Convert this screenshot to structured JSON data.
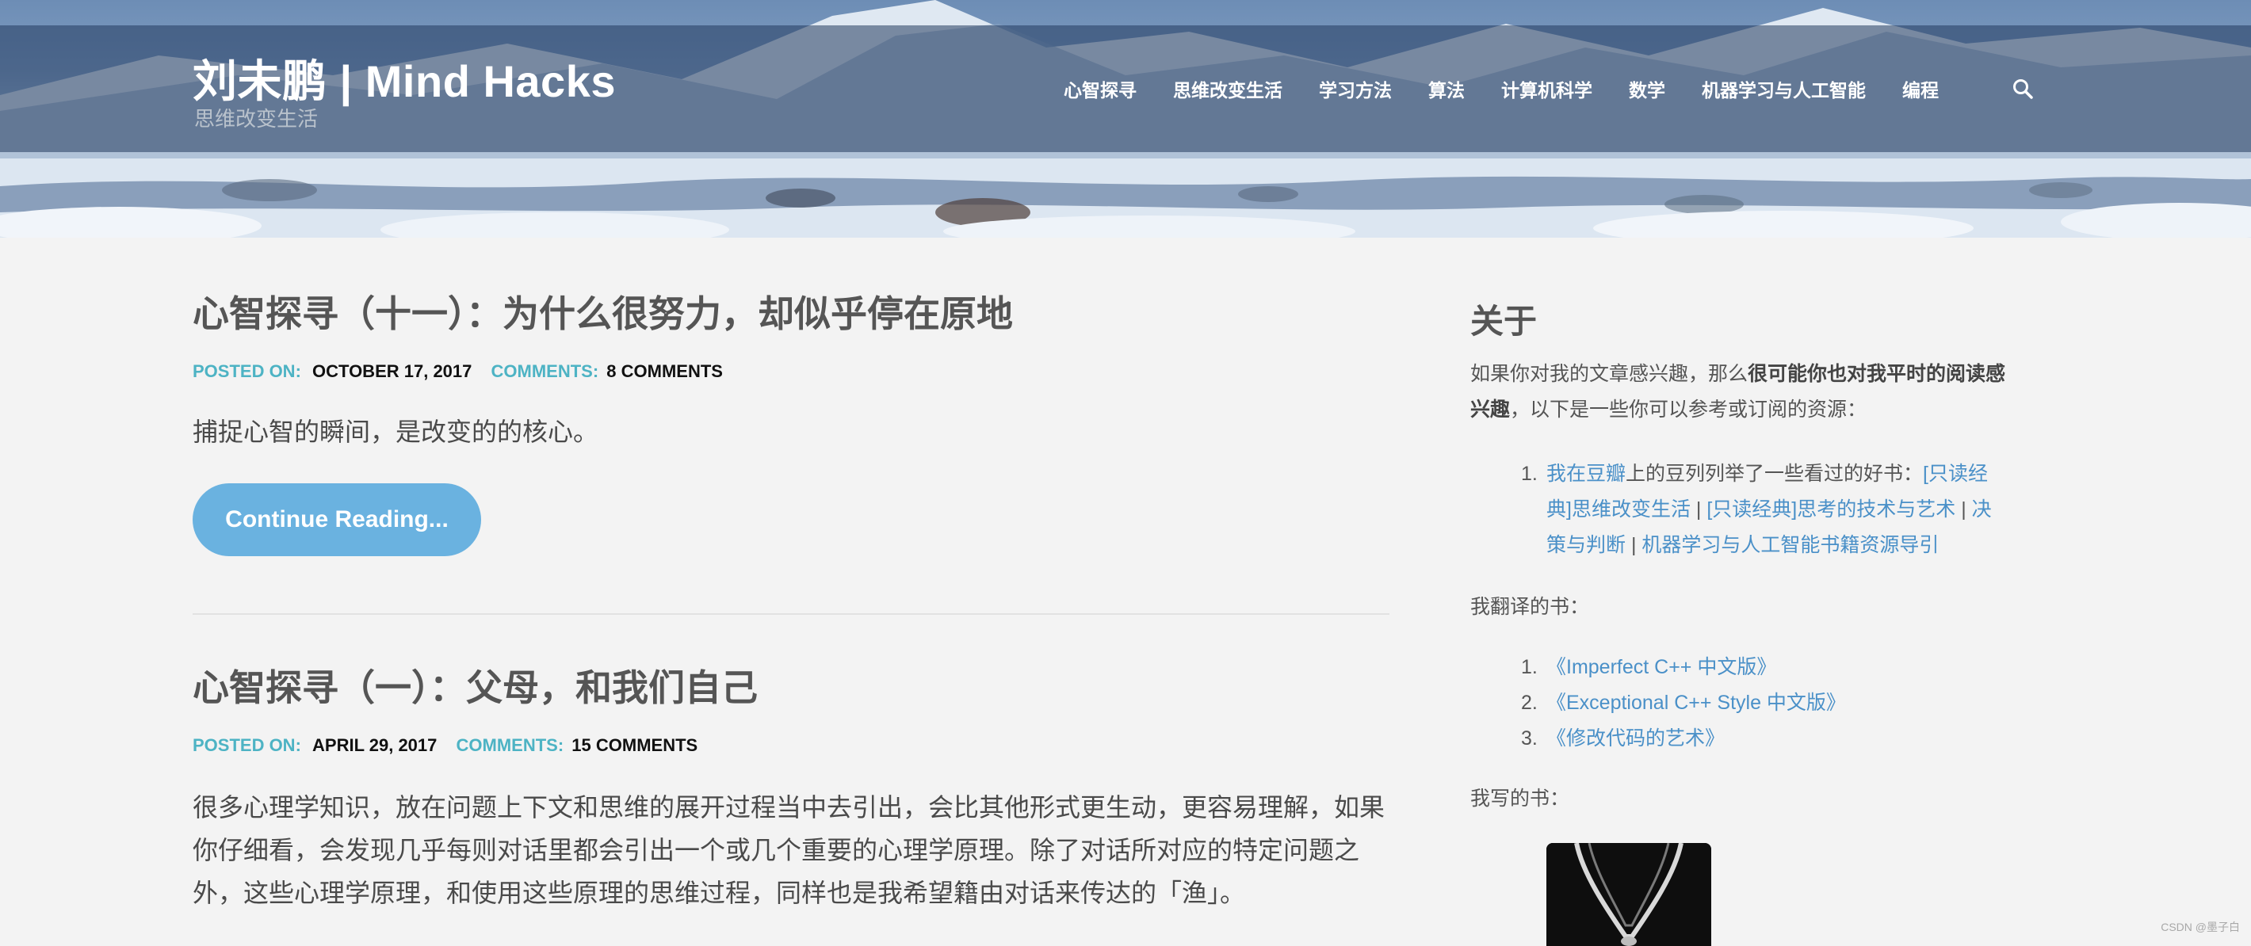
{
  "site": {
    "title": "刘未鹏 | Mind Hacks",
    "tagline": "思维改变生活"
  },
  "nav": {
    "items": [
      "心智探寻",
      "思维改变生活",
      "学习方法",
      "算法",
      "计算机科学",
      "数学",
      "机器学习与人工智能",
      "编程"
    ],
    "search_icon": "search-icon"
  },
  "posts": [
    {
      "title": "心智探寻（十一）：为什么很努力，却似乎停在原地",
      "posted_label": "POSTED ON:",
      "date": "OCTOBER 17, 2017",
      "comments_label": "COMMENTS:",
      "comments": "8 COMMENTS",
      "excerpt": "捕捉心智的瞬间，是改变的的核心。",
      "read_more": "Continue Reading..."
    },
    {
      "title": "心智探寻（一）：父母，和我们自己",
      "posted_label": "POSTED ON:",
      "date": "APRIL 29, 2017",
      "comments_label": "COMMENTS:",
      "comments": "15 COMMENTS",
      "excerpt_lines": [
        "很多心理学知识，放在问题上下文和思维的展开过程当中去引出，会比其他形式更生动，更容易理解，如果",
        "你仔细看，会发现几乎每则对话里都会引出一个或几个重要的心理学原理。除了对话所对应的特定问题之",
        "外，这些心理学原理，和使用这些原理的思维过程，同样也是我希望籍由对话来传达的「渔」。"
      ]
    }
  ],
  "sidebar": {
    "title": "关于",
    "intro": {
      "part1": "如果你对我的文章感兴趣，那么",
      "bold1": "很可能你也对我平时的阅读感",
      "bold2": "兴趣",
      "part2": "，以下是一些你可以参考或订阅的资源："
    },
    "douban": {
      "num": "1.",
      "link": "我在豆瓣",
      "text": "上的豆列列举了一些看过的好书：",
      "list1_a": "[只读经",
      "list1_b": "典]思维改变生活",
      "sep1": " | ",
      "list2": "[只读经典]思考的技术与艺术",
      "sep2": " | ",
      "list3_a": "决",
      "list3_b": "策与判断",
      "sep3": " | ",
      "list4": "机器学习与人工智能书籍资源导引"
    },
    "translated_label": "我翻译的书：",
    "translated": [
      {
        "num": "1.",
        "title": "《Imperfect C++ 中文版》"
      },
      {
        "num": "2.",
        "title": "《Exceptional C++ Style 中文版》"
      },
      {
        "num": "3.",
        "title": "《修改代码的艺术》"
      }
    ],
    "written_label": "我写的书："
  },
  "watermark": "CSDN @墨子白",
  "colors": {
    "accent_meta": "#4db3c4",
    "link": "#4a90c8",
    "button": "#6ab2e0",
    "background": "#f3f3f3"
  }
}
